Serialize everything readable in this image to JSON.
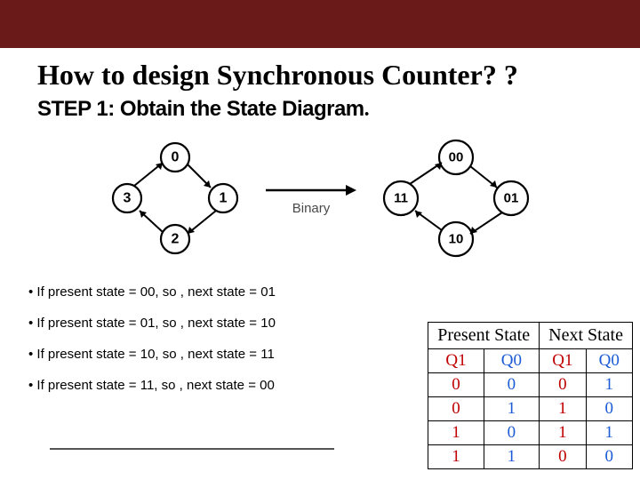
{
  "title": "How to design Synchronous Counter? ?",
  "step": "STEP 1: Obtain the State Diagram",
  "step_dot": ".",
  "diagram_left": {
    "top": "0",
    "right": "1",
    "bottom": "2",
    "left": "3"
  },
  "diagram_right": {
    "top": "00",
    "right": "01",
    "bottom": "10",
    "left": "11"
  },
  "arrow_label": "Binary",
  "bullets": [
    "If   present state = 00,   so , next state = 01",
    "If   present state = 01,   so , next state = 10",
    "If   present state = 10,   so , next state = 11",
    "If   present state = 11,   so , next state = 00"
  ],
  "table": {
    "hdr1": "Present State",
    "hdr2": "Next State",
    "cols": [
      "Q1",
      "Q0",
      "Q1",
      "Q0"
    ],
    "rows": [
      [
        "0",
        "0",
        "0",
        "1"
      ],
      [
        "0",
        "1",
        "1",
        "0"
      ],
      [
        "1",
        "0",
        "1",
        "1"
      ],
      [
        "1",
        "1",
        "0",
        "0"
      ]
    ]
  }
}
